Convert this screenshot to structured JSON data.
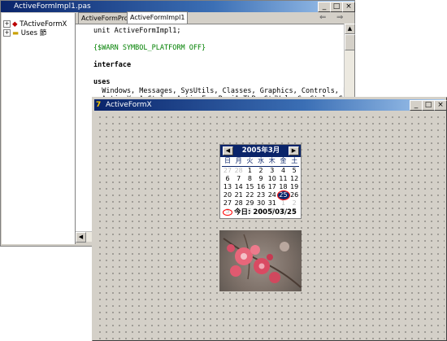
{
  "editor_window": {
    "title": "ActiveFormImpl1.pas",
    "tabs": [
      "ActiveFormProj1",
      "ActiveFormImpl1"
    ],
    "tree": [
      "TActiveFormX",
      "Uses 節"
    ],
    "nav_glyphs": [
      "⇐",
      "⇒"
    ],
    "code_lines": [
      {
        "text": "unit ActiveFormImpl1;",
        "style": "normal"
      },
      {
        "text": "",
        "style": "normal"
      },
      {
        "text": "{$WARN SYMBOL_PLATFORM OFF}",
        "style": "directive"
      },
      {
        "text": "",
        "style": "normal"
      },
      {
        "text": "interface",
        "style": "keyword"
      },
      {
        "text": "",
        "style": "normal"
      },
      {
        "text": "uses",
        "style": "keyword"
      },
      {
        "text": "  Windows, Messages, SysUtils, Classes, Graphics, Controls, Fo",
        "style": "normal"
      },
      {
        "text": "  ActiveX, AxCtrls, ActiveFormProj1_TLB, StdVcl, ComCtrls, Sto",
        "style": "normal"
      },
      {
        "text": "  ExtCtrls;",
        "style": "normal"
      }
    ]
  },
  "form_window": {
    "title": "ActiveFormX"
  },
  "calendar": {
    "month_label": "2005年3月",
    "prev": "◀",
    "next": "▶",
    "weekdays": [
      "日",
      "月",
      "火",
      "水",
      "木",
      "金",
      "土"
    ],
    "rows": [
      [
        "27",
        "28",
        "1",
        "2",
        "3",
        "4",
        "5"
      ],
      [
        "6",
        "7",
        "8",
        "9",
        "10",
        "11",
        "12"
      ],
      [
        "13",
        "14",
        "15",
        "16",
        "17",
        "18",
        "19"
      ],
      [
        "20",
        "21",
        "22",
        "23",
        "24",
        "25",
        "26"
      ],
      [
        "27",
        "28",
        "29",
        "30",
        "31",
        "1",
        "2"
      ],
      [
        "3",
        "4",
        "5",
        "6",
        "7",
        "8",
        "9"
      ]
    ],
    "today_label": "今日: 2005/03/25"
  },
  "colors": {
    "title_active": "#0a246a",
    "directive": "#008000",
    "calendar_header": "#0a246a",
    "grey_date": "#c0c0c0",
    "today_circle": "#ff0000"
  }
}
